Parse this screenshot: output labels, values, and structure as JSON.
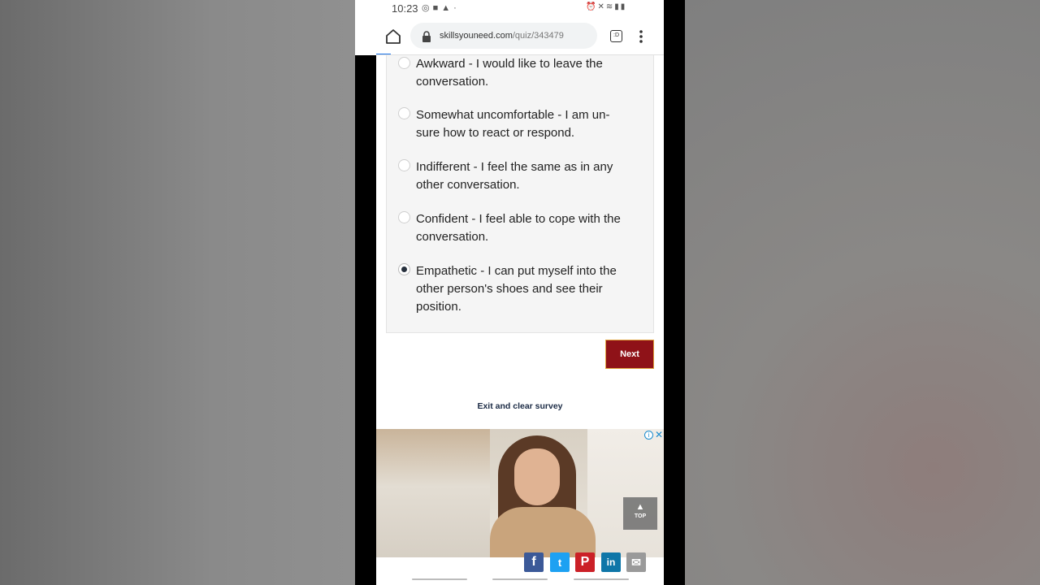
{
  "status_bar": {
    "time": "10:23",
    "left_icons": [
      "whatsapp-icon",
      "video-icon",
      "warning-icon",
      "dot-icon"
    ],
    "right_icons": [
      "alarm-icon",
      "mute-icon",
      "wifi-icon",
      "signal-icon",
      "battery-icon"
    ]
  },
  "browser": {
    "url_domain": "skillsyouneed.com",
    "url_path": "/quiz/343479",
    "tabs_count": ":D"
  },
  "quiz": {
    "options": [
      {
        "label": "Awkward - I would like to leave the conversation.",
        "selected": false
      },
      {
        "label": "Somewhat uncomfortable - I am un-sure how to react or respond.",
        "selected": false
      },
      {
        "label": "Indifferent - I feel the same as in any other conversation.",
        "selected": false
      },
      {
        "label": "Confident - I feel able to cope with the conversation.",
        "selected": false
      },
      {
        "label": "Empathetic - I can put myself into the other person's shoes and see their position.",
        "selected": true
      }
    ],
    "next_label": "Next",
    "exit_label": "Exit and clear survey"
  },
  "ad": {
    "info_label": "i",
    "close_label": "✕",
    "top_label": "TOP"
  },
  "share": {
    "facebook": "f",
    "twitter": "t",
    "pinterest": "P",
    "linkedin": "in",
    "email": "✉"
  },
  "colors": {
    "next_button": "#8f1218",
    "next_border": "#e0a43c",
    "link": "#1a2a44",
    "progress": "#1a73e8"
  }
}
